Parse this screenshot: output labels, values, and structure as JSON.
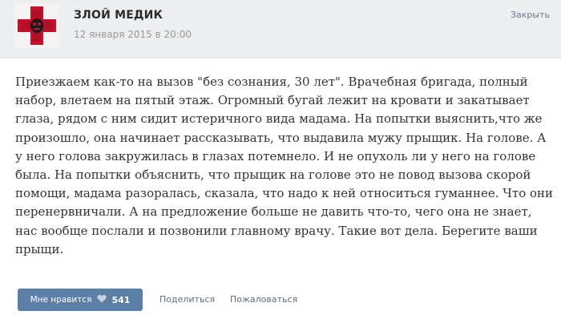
{
  "header": {
    "group_name": "ЗЛОЙ МЕДИК",
    "date": "12 января 2015 в 20:00",
    "close_label": "Закрыть"
  },
  "post": {
    "lines": [
      "Приезжаем как-то на вызов \"без сознания, 30 лет\". Врачебная бригада, полный",
      "набор, влетаем на пятый этаж. Огромный бугай лежит на кровати и закатывает",
      "глаза, рядом с ним сидит истеричного вида мадама. На попытки выяснить,что же",
      "произошло, она начинает рассказывать, что выдавила мужу прыщик. На голове. А",
      "у него голова закружилась в глазах потемнело. И не опухоль ли у него на голове",
      "была. На попытки объяснить, что прыщик на голове это не повод вызова скорой",
      "помощи, мадама разоралась, сказала, что надо к ней относиться гуманнее. Что они",
      "перенервничали. А на предложение больше не давить что-то, чего она не знает,",
      "нас вообще послали и позвонили главному врачу. Такие вот дела. Берегите ваши",
      "прыщи."
    ]
  },
  "actions": {
    "like_label": "Мне нравится",
    "like_count": "541",
    "share_label": "Поделиться",
    "report_label": "Пожаловаться"
  },
  "icons": {
    "avatar": "red-cross-logo",
    "like": "heart-icon"
  },
  "colors": {
    "header_bg": "#edeef0",
    "like_button": "#5b7fa6",
    "avatar_cross": "#c8102e"
  }
}
